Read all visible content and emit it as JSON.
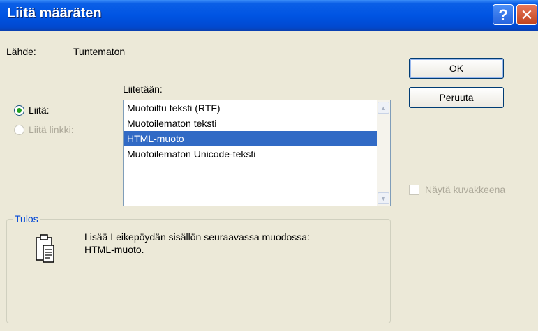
{
  "window": {
    "title": "Liitä määräten",
    "help_symbol": "?",
    "close_symbol": "✕"
  },
  "source": {
    "label": "Lähde:",
    "value": "Tuntematon"
  },
  "buttons": {
    "ok": "OK",
    "cancel": "Peruuta"
  },
  "list_label": "Liitetään:",
  "options": {
    "paste": "Liitä:",
    "paste_link": "Liitä linkki:",
    "selected": "paste"
  },
  "formats": [
    "Muotoiltu teksti (RTF)",
    "Muotoilematon teksti",
    "HTML-muoto",
    "Muotoilematon Unicode-teksti"
  ],
  "selected_format": "HTML-muoto",
  "display_as_icon": {
    "label": "Näytä kuvakkeena",
    "checked": false
  },
  "result": {
    "label": "Tulos",
    "line1": "Lisää Leikepöydän sisällön seuraavassa muodossa:",
    "line2": "HTML-muoto."
  },
  "icons": [
    "help-icon",
    "close-icon",
    "scroll-up-icon",
    "scroll-down-icon",
    "clipboard-icon"
  ],
  "colors": {
    "titlebar": "#0054e3",
    "selection": "#316ac5",
    "radio_dot": "#21a121",
    "group_label": "#0046d5"
  }
}
